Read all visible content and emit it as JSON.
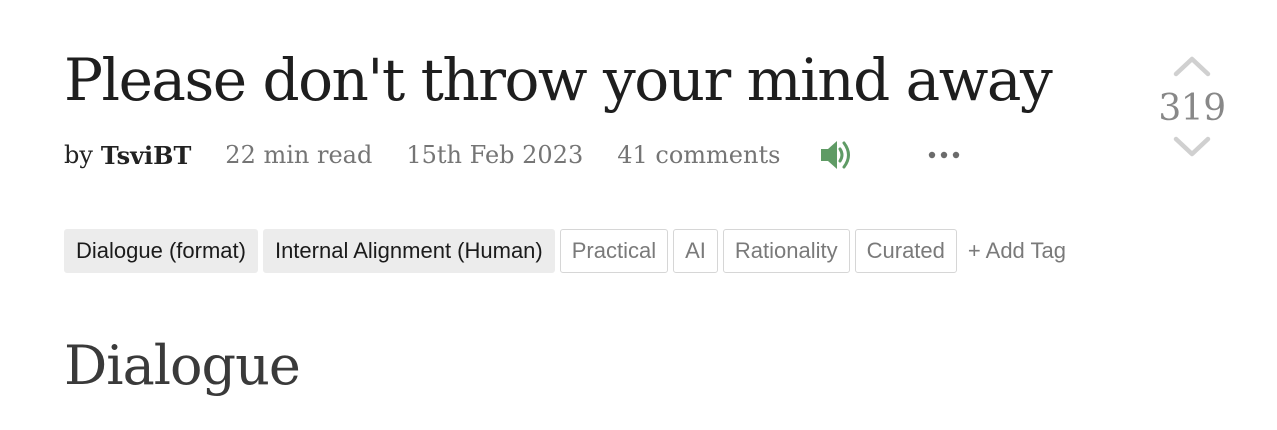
{
  "post": {
    "title": "Please don't throw your mind away",
    "by_label": "by",
    "author": "TsviBT",
    "read_time": "22 min read",
    "date": "15th Feb 2023",
    "comments": "41 comments",
    "audio_icon": "speaker-icon",
    "more_icon": "ellipsis-icon"
  },
  "vote": {
    "score": "319",
    "up_icon": "chevron-up-icon",
    "down_icon": "chevron-down-icon"
  },
  "tags": {
    "core": [
      "Dialogue (format)",
      "Internal Alignment (Human)"
    ],
    "regular": [
      "Practical",
      "AI",
      "Rationality",
      "Curated"
    ],
    "add_label": "+ Add Tag"
  },
  "content": {
    "first_heading": "Dialogue"
  },
  "colors": {
    "audio_accent": "#5f9b65",
    "text_dark": "#1e1e1e",
    "text_muted": "#757575",
    "core_tag_bg": "#ececec"
  }
}
